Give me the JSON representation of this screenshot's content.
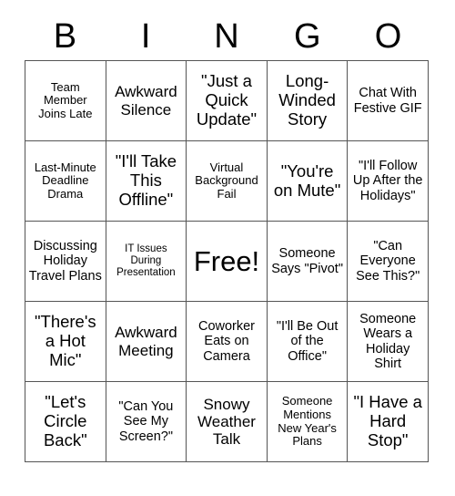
{
  "card": {
    "header_letters": [
      "B",
      "I",
      "N",
      "G",
      "O"
    ],
    "rows": [
      [
        {
          "text": "Team Member Joins Late",
          "size": "sm"
        },
        {
          "text": "Awkward Silence",
          "size": "lg"
        },
        {
          "text": "\"Just a Quick Update\"",
          "size": "xl"
        },
        {
          "text": "Long-Winded Story",
          "size": "xl"
        },
        {
          "text": "Chat With Festive GIF",
          "size": "md"
        }
      ],
      [
        {
          "text": "Last-Minute Deadline Drama",
          "size": "sm"
        },
        {
          "text": "\"I'll Take This Offline\"",
          "size": "xl"
        },
        {
          "text": "Virtual Background Fail",
          "size": "sm"
        },
        {
          "text": "\"You're on Mute\"",
          "size": "xl"
        },
        {
          "text": "\"I'll Follow Up After the Holidays\"",
          "size": "md"
        }
      ],
      [
        {
          "text": "Discussing Holiday Travel Plans",
          "size": "md"
        },
        {
          "text": "IT Issues During Presentation",
          "size": "xs"
        },
        {
          "text": "Free!",
          "size": "free"
        },
        {
          "text": "Someone Says \"Pivot\"",
          "size": "md"
        },
        {
          "text": "\"Can Everyone See This?\"",
          "size": "md"
        }
      ],
      [
        {
          "text": "\"There's a Hot Mic\"",
          "size": "xl"
        },
        {
          "text": "Awkward Meeting",
          "size": "lg"
        },
        {
          "text": "Coworker Eats on Camera",
          "size": "md"
        },
        {
          "text": "\"I'll Be Out of the Office\"",
          "size": "md"
        },
        {
          "text": "Someone Wears a Holiday Shirt",
          "size": "md"
        }
      ],
      [
        {
          "text": "\"Let's Circle Back\"",
          "size": "xl"
        },
        {
          "text": "\"Can You See My Screen?\"",
          "size": "md"
        },
        {
          "text": "Snowy Weather Talk",
          "size": "lg"
        },
        {
          "text": "Someone Mentions New Year's Plans",
          "size": "sm"
        },
        {
          "text": "\"I Have a Hard Stop\"",
          "size": "xl"
        }
      ]
    ]
  }
}
